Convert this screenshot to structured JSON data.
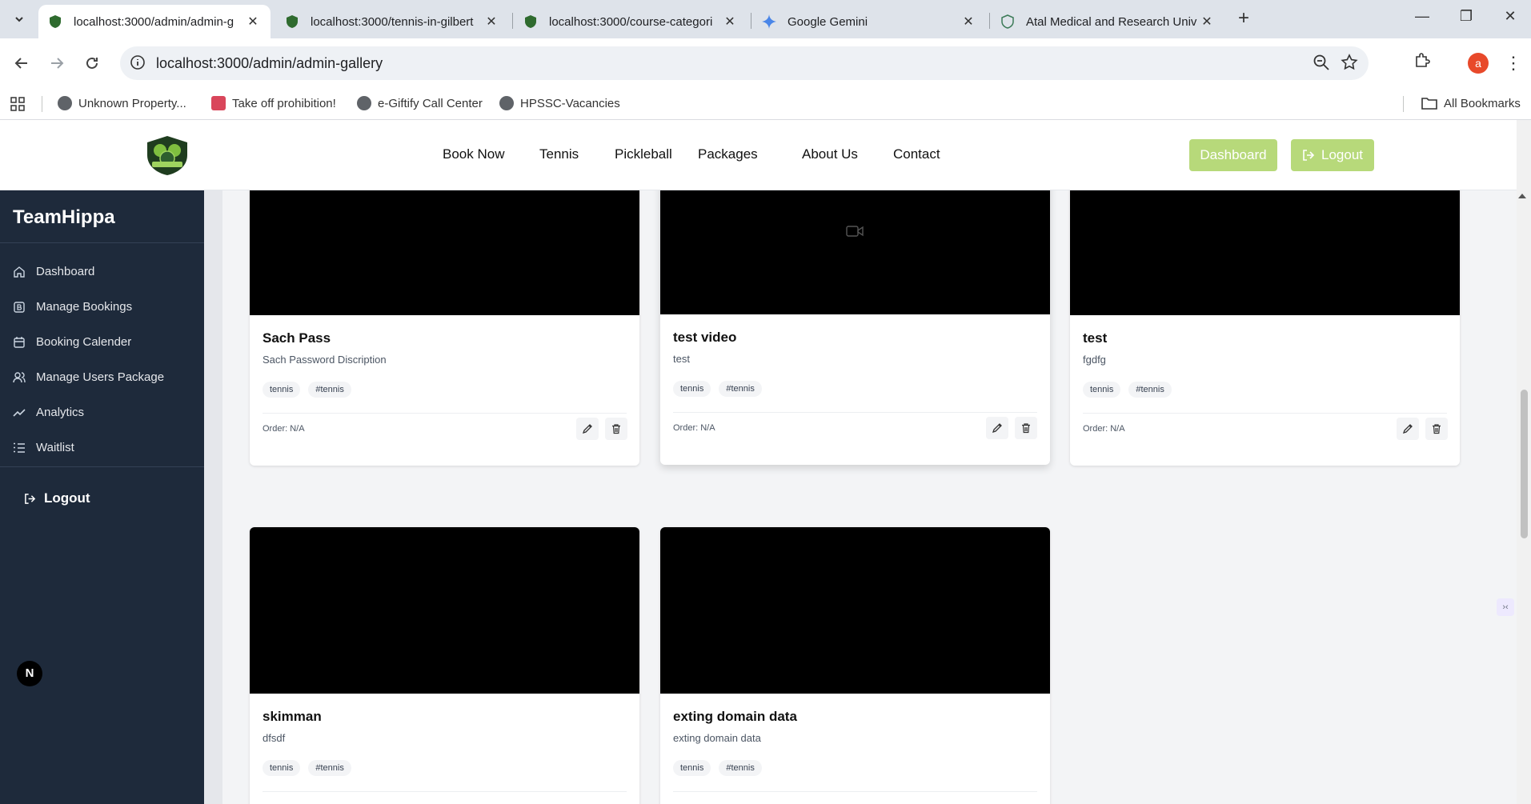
{
  "browser": {
    "tabs": [
      {
        "title": "localhost:3000/admin/admin-g",
        "active": true
      },
      {
        "title": "localhost:3000/tennis-in-gilbert",
        "active": false
      },
      {
        "title": "localhost:3000/course-categori",
        "active": false
      },
      {
        "title": "Google Gemini",
        "active": false
      },
      {
        "title": "Atal Medical and Research Univ",
        "active": false
      }
    ],
    "url": "localhost:3000/admin/admin-gallery",
    "profile_initial": "a",
    "bookmarks": [
      "Unknown Property...",
      "Take off prohibition!",
      "e-Giftify Call Center",
      "HPSSC-Vacancies"
    ],
    "all_bookmarks": "All Bookmarks"
  },
  "header": {
    "nav": [
      "Book Now",
      "Tennis",
      "Pickleball",
      "Packages",
      "About Us",
      "Contact"
    ],
    "dashboard_label": "Dashboard",
    "logout_label": "Logout",
    "accent_color": "#b7d97a"
  },
  "sidebar": {
    "brand": "TeamHippa",
    "items": [
      {
        "label": "Dashboard",
        "icon": "home-icon"
      },
      {
        "label": "Manage Bookings",
        "icon": "bookings-icon"
      },
      {
        "label": "Booking Calender",
        "icon": "calendar-icon"
      },
      {
        "label": "Manage Users Package",
        "icon": "users-icon"
      },
      {
        "label": "Analytics",
        "icon": "trend-icon"
      },
      {
        "label": "Waitlist",
        "icon": "list-icon"
      }
    ],
    "logout_label": "Logout"
  },
  "gallery": {
    "cards": [
      {
        "title": "Sach Pass",
        "description": "Sach Password Discription",
        "tags": [
          "tennis",
          "#tennis"
        ],
        "order": "Order: N/A",
        "video": false
      },
      {
        "title": "test video",
        "description": "test",
        "tags": [
          "tennis",
          "#tennis"
        ],
        "order": "Order: N/A",
        "video": true
      },
      {
        "title": "test",
        "description": "fgdfg",
        "tags": [
          "tennis",
          "#tennis"
        ],
        "order": "Order: N/A",
        "video": false
      },
      {
        "title": "skimman",
        "description": "dfsdf",
        "tags": [
          "tennis",
          "#tennis"
        ],
        "order": "",
        "video": false
      },
      {
        "title": "exting domain data",
        "description": "exting domain data",
        "tags": [
          "tennis",
          "#tennis"
        ],
        "order": "",
        "video": false
      }
    ]
  },
  "next_badge": "N"
}
